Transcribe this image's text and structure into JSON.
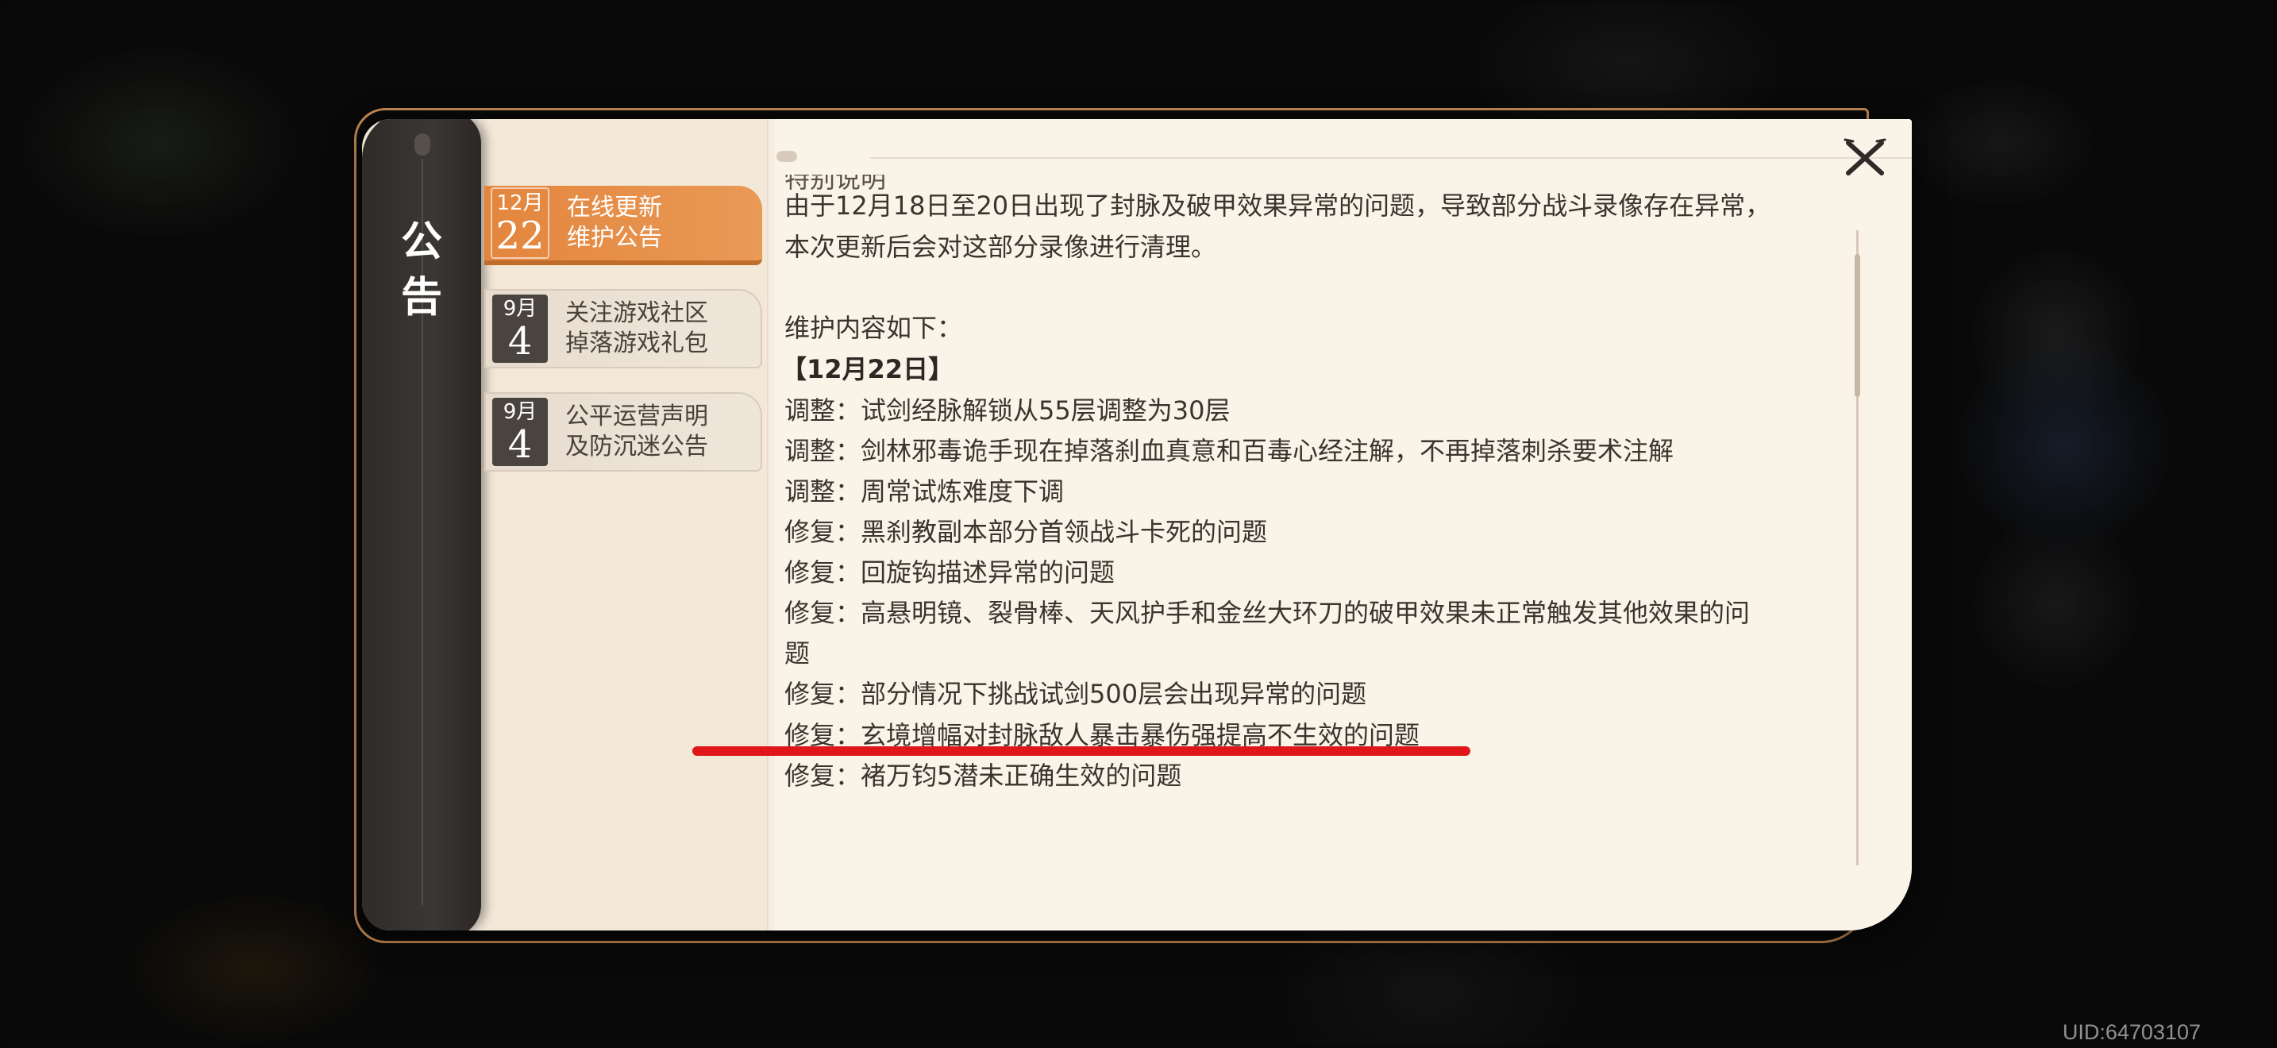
{
  "uid": "UID:64703107",
  "sidebar": {
    "title_line1": "公",
    "title_line2": "告"
  },
  "tabs": [
    {
      "month": "12月",
      "day": "22",
      "title_line1": "在线更新",
      "title_line2": "维护公告",
      "active": true
    },
    {
      "month": "9月",
      "day": "4",
      "title_line1": "关注游戏社区",
      "title_line2": "掉落游戏礼包",
      "active": false
    },
    {
      "month": "9月",
      "day": "4",
      "title_line1": "公平运营声明",
      "title_line2": "及防沉迷公告",
      "active": false
    }
  ],
  "content": {
    "partial_heading": "特别说明",
    "lines": [
      "由于12月18日至20日出现了封脉及破甲效果异常的问题，导致部分战斗录像存在异常，",
      "本次更新后会对这部分录像进行清理。",
      "维护内容如下：",
      "【12月22日】",
      "调整：试剑经脉解锁从55层调整为30层",
      "调整：剑林邪毒诡手现在掉落刹血真意和百毒心经注解，不再掉落刺杀要术注解",
      "调整：周常试炼难度下调",
      "修复：黑刹教副本部分首领战斗卡死的问题",
      "修复：回旋钩描述异常的问题",
      "修复：高悬明镜、裂骨棒、天风护手和金丝大环刀的破甲效果未正常触发其他效果的问",
      "题",
      "修复：部分情况下挑战试剑500层会出现异常的问题",
      "修复：玄境增幅对封脉敌人暴击暴伤强提高不生效的问题",
      "修复：褚万钧5潜未正确生效的问题"
    ]
  },
  "colors": {
    "accent": "#e3853e",
    "annotation_red": "#e0161a",
    "panel_bg": "#faf3e8"
  },
  "icons": {
    "close": "close-icon"
  }
}
